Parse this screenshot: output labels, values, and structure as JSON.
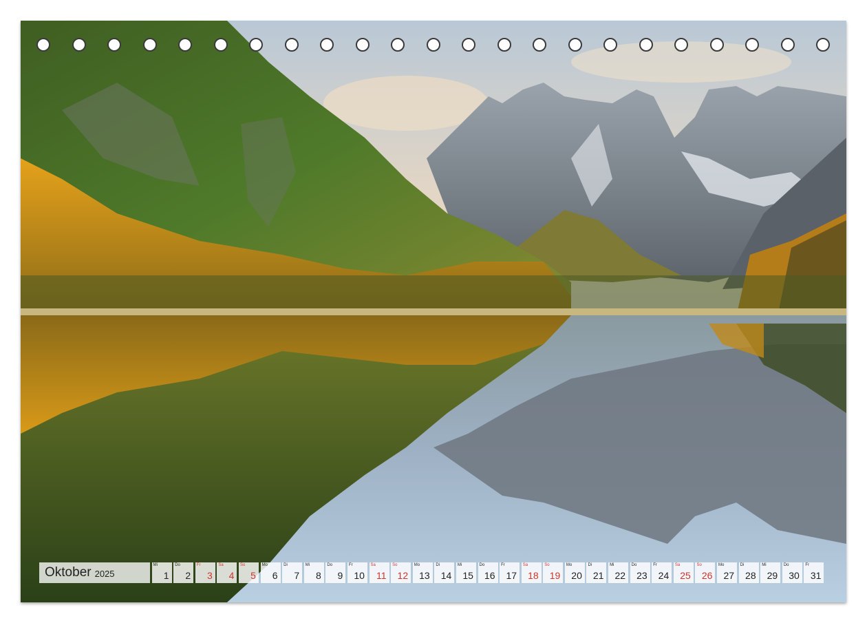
{
  "calendar": {
    "month": "Oktober",
    "year": "2025",
    "weekend_color": "#d0342c",
    "days": [
      {
        "d": "1",
        "w": "Mi",
        "we": false
      },
      {
        "d": "2",
        "w": "Do",
        "we": false
      },
      {
        "d": "3",
        "w": "Fr",
        "we": true
      },
      {
        "d": "4",
        "w": "Sa",
        "we": true
      },
      {
        "d": "5",
        "w": "So",
        "we": true
      },
      {
        "d": "6",
        "w": "Mo",
        "we": false
      },
      {
        "d": "7",
        "w": "Di",
        "we": false
      },
      {
        "d": "8",
        "w": "Mi",
        "we": false
      },
      {
        "d": "9",
        "w": "Do",
        "we": false
      },
      {
        "d": "10",
        "w": "Fr",
        "we": false
      },
      {
        "d": "11",
        "w": "Sa",
        "we": true
      },
      {
        "d": "12",
        "w": "So",
        "we": true
      },
      {
        "d": "13",
        "w": "Mo",
        "we": false
      },
      {
        "d": "14",
        "w": "Di",
        "we": false
      },
      {
        "d": "15",
        "w": "Mi",
        "we": false
      },
      {
        "d": "16",
        "w": "Do",
        "we": false
      },
      {
        "d": "17",
        "w": "Fr",
        "we": false
      },
      {
        "d": "18",
        "w": "Sa",
        "we": true
      },
      {
        "d": "19",
        "w": "So",
        "we": true
      },
      {
        "d": "20",
        "w": "Mo",
        "we": false
      },
      {
        "d": "21",
        "w": "Di",
        "we": false
      },
      {
        "d": "22",
        "w": "Mi",
        "we": false
      },
      {
        "d": "23",
        "w": "Do",
        "we": false
      },
      {
        "d": "24",
        "w": "Fr",
        "we": false
      },
      {
        "d": "25",
        "w": "Sa",
        "we": true
      },
      {
        "d": "26",
        "w": "So",
        "we": true
      },
      {
        "d": "27",
        "w": "Mo",
        "we": false
      },
      {
        "d": "28",
        "w": "Di",
        "we": false
      },
      {
        "d": "29",
        "w": "Mi",
        "we": false
      },
      {
        "d": "30",
        "w": "Do",
        "we": false
      },
      {
        "d": "31",
        "w": "Fr",
        "we": false
      }
    ]
  },
  "binding": {
    "hole_count": 23
  }
}
